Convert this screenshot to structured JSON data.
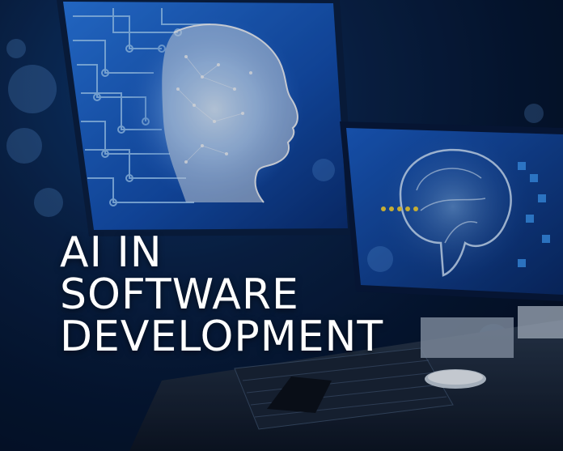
{
  "headline": {
    "line1": "AI IN",
    "line2": "SOFTWARE",
    "line3": "DEVELOPMENT"
  },
  "colors": {
    "background": "#06162c",
    "screen_glow": "#1f6fe0",
    "circuit": "#9fd0ff",
    "headline_text": "#ffffff",
    "brain_dot": "#f2d23a"
  }
}
